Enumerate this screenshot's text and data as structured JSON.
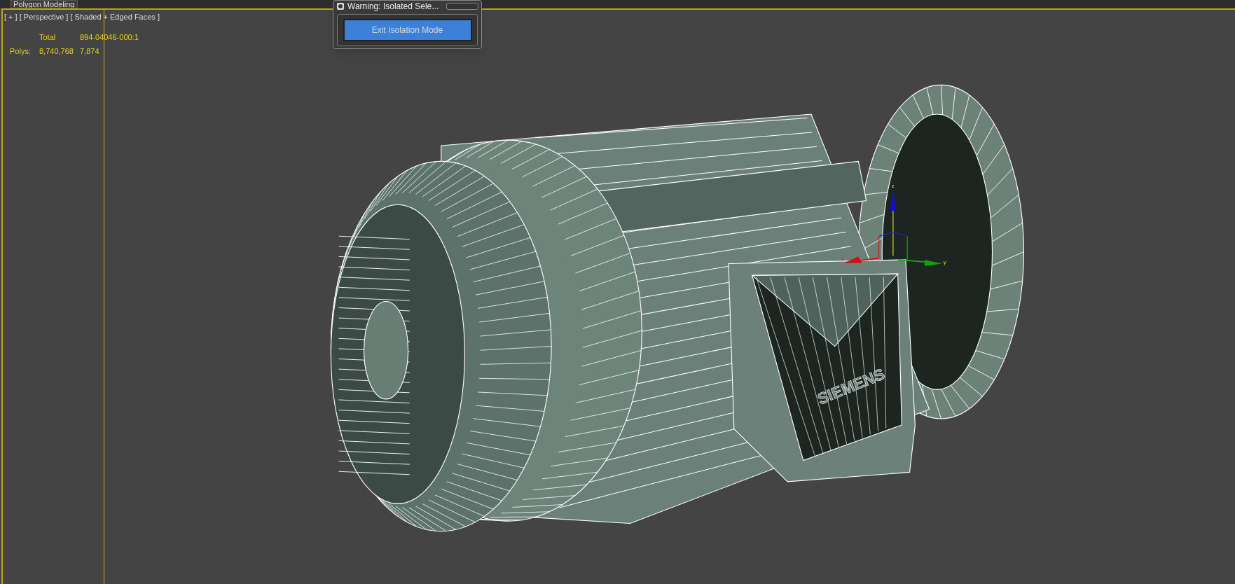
{
  "toolbar_tab": {
    "label": "Polygon Modeling"
  },
  "viewport": {
    "label": "[ + ] [ Perspective ] [ Shaded + Edged Faces ]",
    "stats": {
      "columns": [
        "Total",
        "894-04046-000:1"
      ],
      "rows": [
        {
          "label": "Polys:",
          "values": [
            "8,740,768",
            "7,874"
          ]
        }
      ]
    },
    "model": {
      "logo": "SIEMENS"
    },
    "gizmo": {
      "axes": [
        "x",
        "y",
        "z"
      ]
    }
  },
  "dialog": {
    "title": "Warning: Isolated Sele...",
    "button": "Exit Isolation Mode"
  }
}
